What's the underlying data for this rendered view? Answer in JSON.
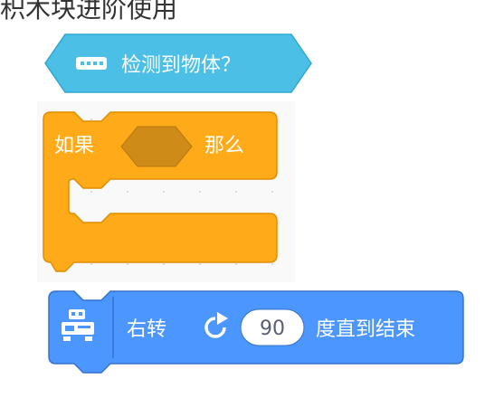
{
  "top_text": "积木块进阶使用",
  "sensor_block": {
    "label": "检测到物体？",
    "color": "#4cbfe6",
    "icon": "sensor-icon"
  },
  "if_block": {
    "if_label": "如果",
    "then_label": "那么",
    "color": "#ffab19",
    "condition_color": "#cf8b17"
  },
  "turn_block": {
    "label_prefix": "右转",
    "value": "90",
    "label_suffix": "度直到结束",
    "color": "#4c97ff",
    "icon": "robot-icon",
    "turn_icon": "rotate-clockwise-icon"
  }
}
